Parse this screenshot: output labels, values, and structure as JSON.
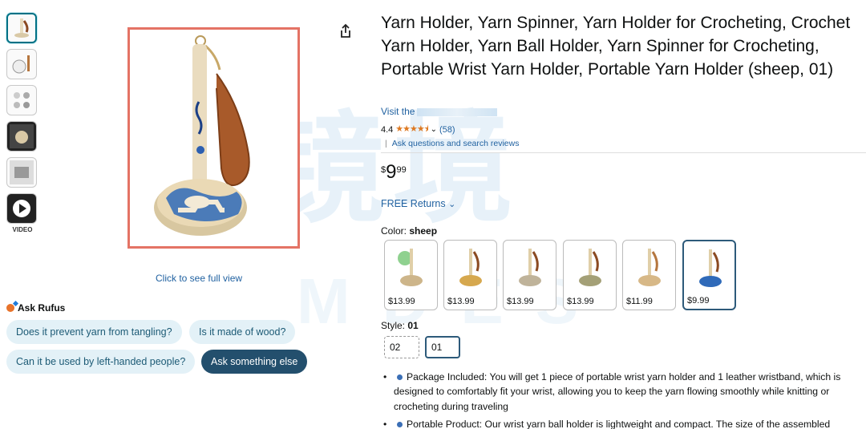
{
  "thumbnails": {
    "video_label": "VIDEO"
  },
  "main_image": {
    "see_full_view": "Click to see full view"
  },
  "rufus": {
    "title": "Ask Rufus",
    "chips": [
      "Does it prevent yarn from tangling?",
      "Is it made of wood?",
      "Can it be used by left-handed people?",
      "Ask something else"
    ]
  },
  "product": {
    "title": "Yarn Holder, Yarn Spinner, Yarn Holder for Crocheting, Crochet Yarn Holder, Yarn Ball Holder, Yarn Spinner for Crocheting, Portable Wrist Yarn Holder, Portable Yarn Holder (sheep, 01)",
    "visit_prefix": "Visit the",
    "rating_value": "4.4",
    "rating_stars": "★★★★⯨",
    "rating_count": "(58)",
    "ask_reviews": "Ask questions and search reviews",
    "price_symbol": "$",
    "price_whole": "9",
    "price_fraction": "99",
    "returns": "FREE Returns",
    "color_label": "Color:",
    "color_selected": "sheep",
    "swatch_prices": [
      "$13.99",
      "$13.99",
      "$13.99",
      "$13.99",
      "$11.99",
      "$9.99"
    ],
    "style_label": "Style:",
    "style_selected": "01",
    "style_options": [
      "02",
      "01"
    ],
    "bullets": [
      "Package Included: You will get 1 piece of portable wrist yarn holder and 1 leather wristband, which is designed to comfortably fit your wrist, allowing you to keep the yarn flowing smoothly while knitting or crocheting during traveling",
      "Portable Product: Our wrist yarn ball holder is lightweight and compact. The size of the assembled"
    ]
  },
  "colors": {
    "link": "#2162a1",
    "star": "#de7921",
    "selected_border": "#2d5a7a",
    "image_border": "#e47365",
    "chip_bg": "#e3f1f7",
    "chip_dark_bg": "#234f6d"
  }
}
